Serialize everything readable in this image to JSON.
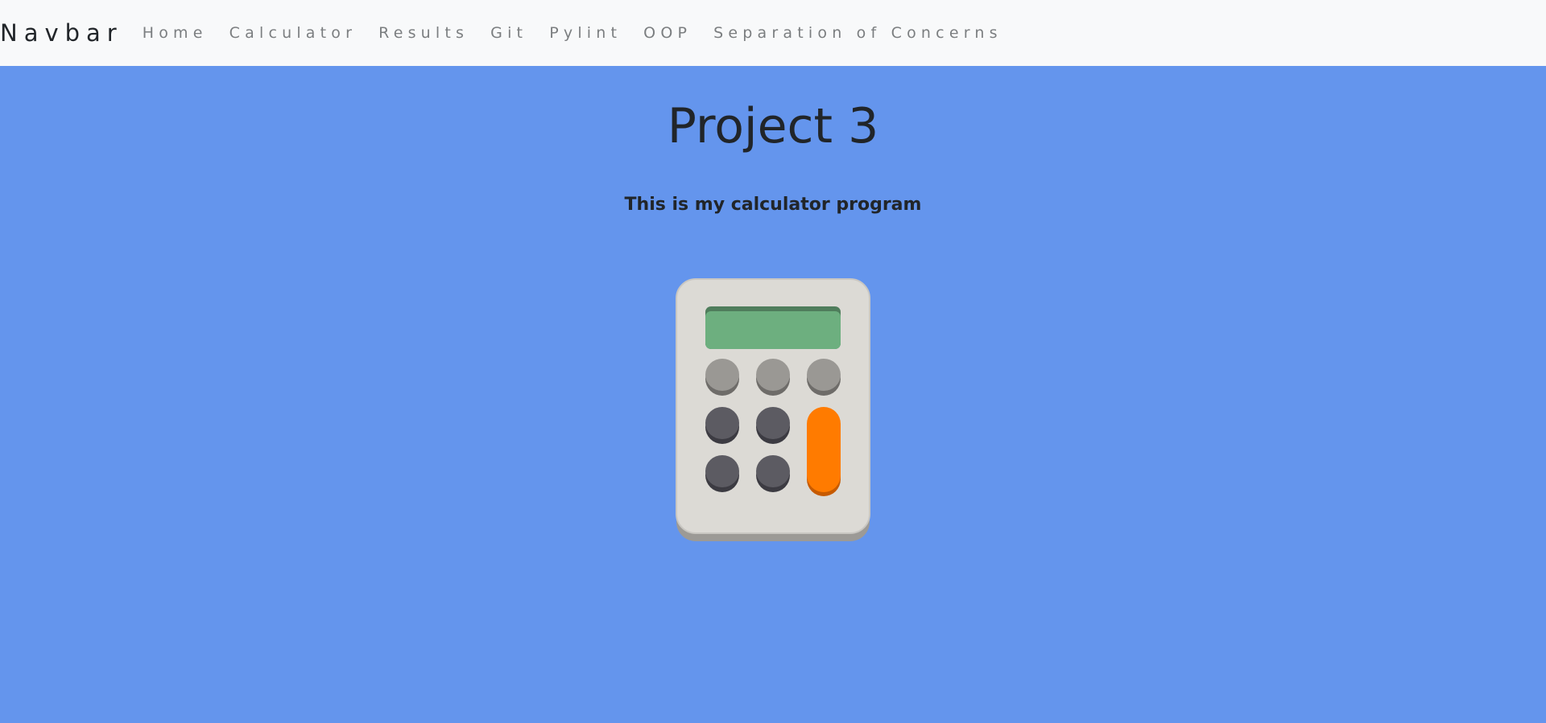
{
  "navbar": {
    "brand": "Navbar",
    "items": [
      {
        "label": "Home"
      },
      {
        "label": "Calculator"
      },
      {
        "label": "Results"
      },
      {
        "label": "Git"
      },
      {
        "label": "Pylint"
      },
      {
        "label": "OOP"
      },
      {
        "label": "Separation of Concerns"
      }
    ]
  },
  "main": {
    "title": "Project 3",
    "subtitle": "This is my calculator program",
    "image": {
      "icon": "calculator-icon"
    }
  },
  "colors": {
    "background": "#6495ed",
    "navbar_bg": "#f8f9fa",
    "text": "#212529",
    "nav_link": "#7b7e80",
    "calc_body": "#dcdad5",
    "calc_screen": "#6daf7f",
    "calc_key_light": "#9a9894",
    "calc_key_dark": "#5c5b62",
    "calc_key_accent": "#ff7b00"
  }
}
